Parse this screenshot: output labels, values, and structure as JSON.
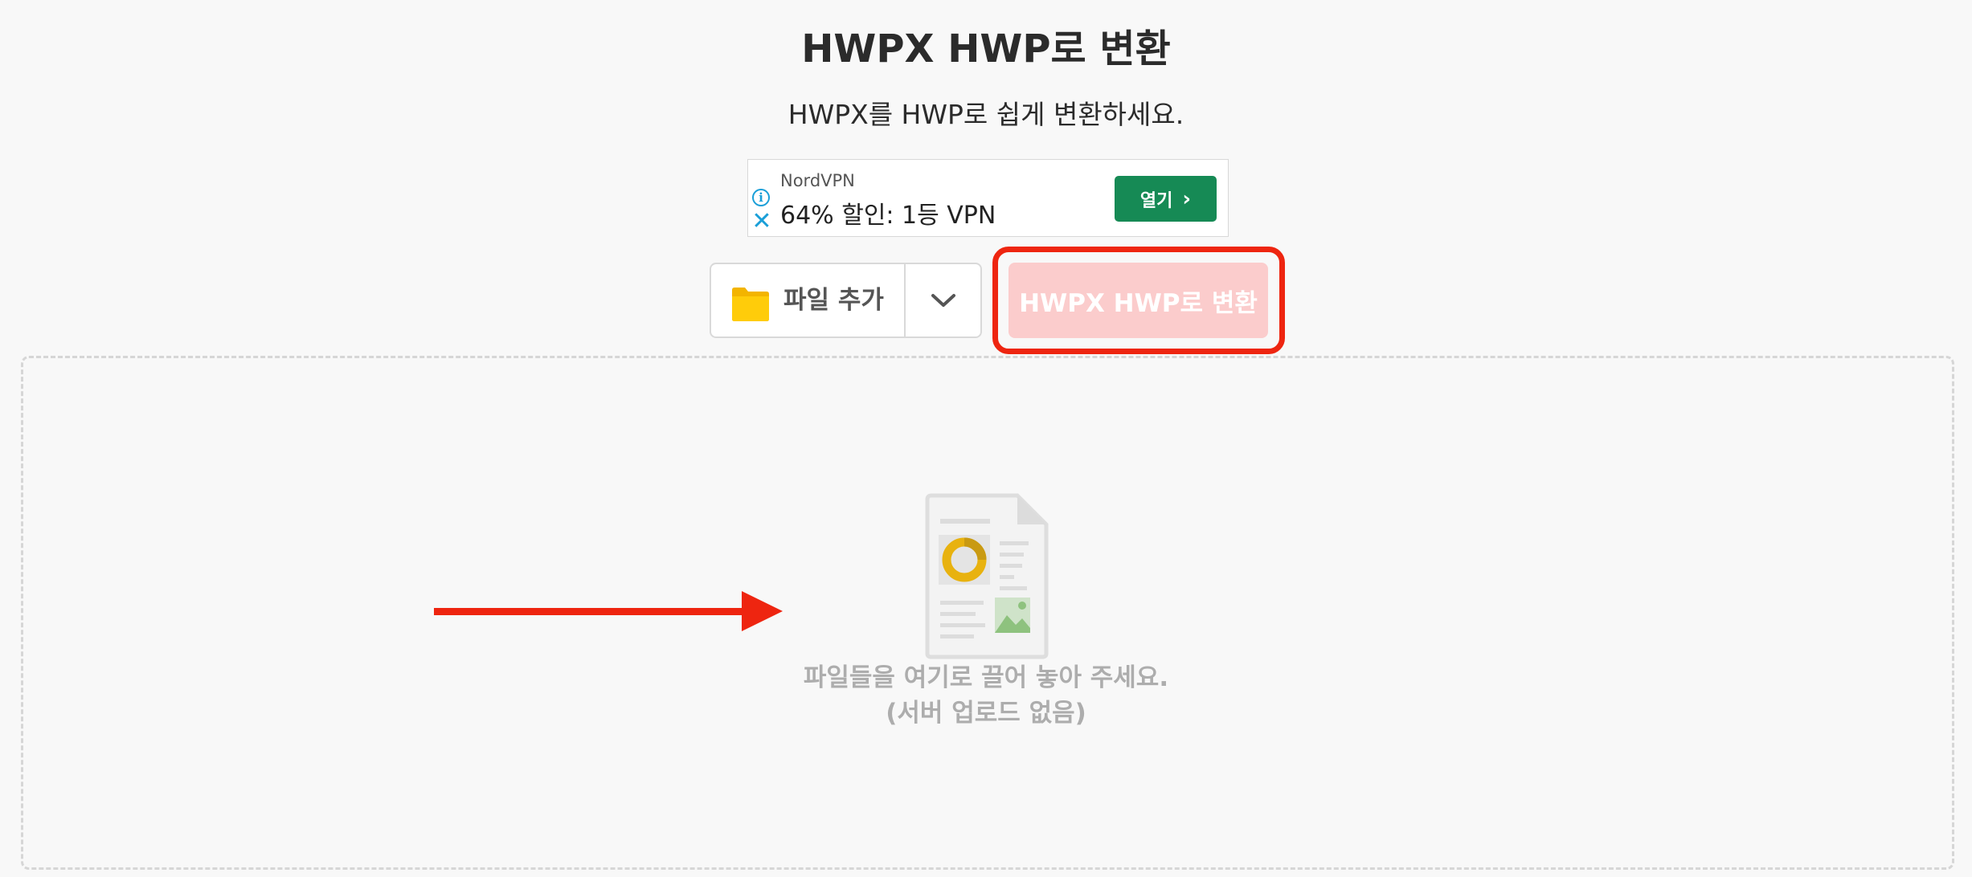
{
  "page": {
    "title": "HWPX HWP로 변환",
    "subtitle": "HWPX를 HWP로 쉽게 변환하세요."
  },
  "ad": {
    "brand": "NordVPN",
    "text": "64% 할인: 1등 VPN",
    "open_label": "열기",
    "info_icon": "info-icon",
    "close_icon": "close-icon",
    "accent": "#168a55"
  },
  "toolbar": {
    "add_file_label": "파일 추가",
    "convert_label": "HWPX HWP로 변환",
    "folder_icon": "folder-icon",
    "dropdown_icon": "chevron-down-icon"
  },
  "dropzone": {
    "line1": "파일들을 여기로 끌어 놓아 주세요.",
    "line2": "(서버 업로드 없음)",
    "icon": "document-icon"
  },
  "colors": {
    "background": "#f8f8f8",
    "highlight_outline": "#ee2510",
    "convert_button": "#fbcccc",
    "arrow": "#ee2510"
  }
}
